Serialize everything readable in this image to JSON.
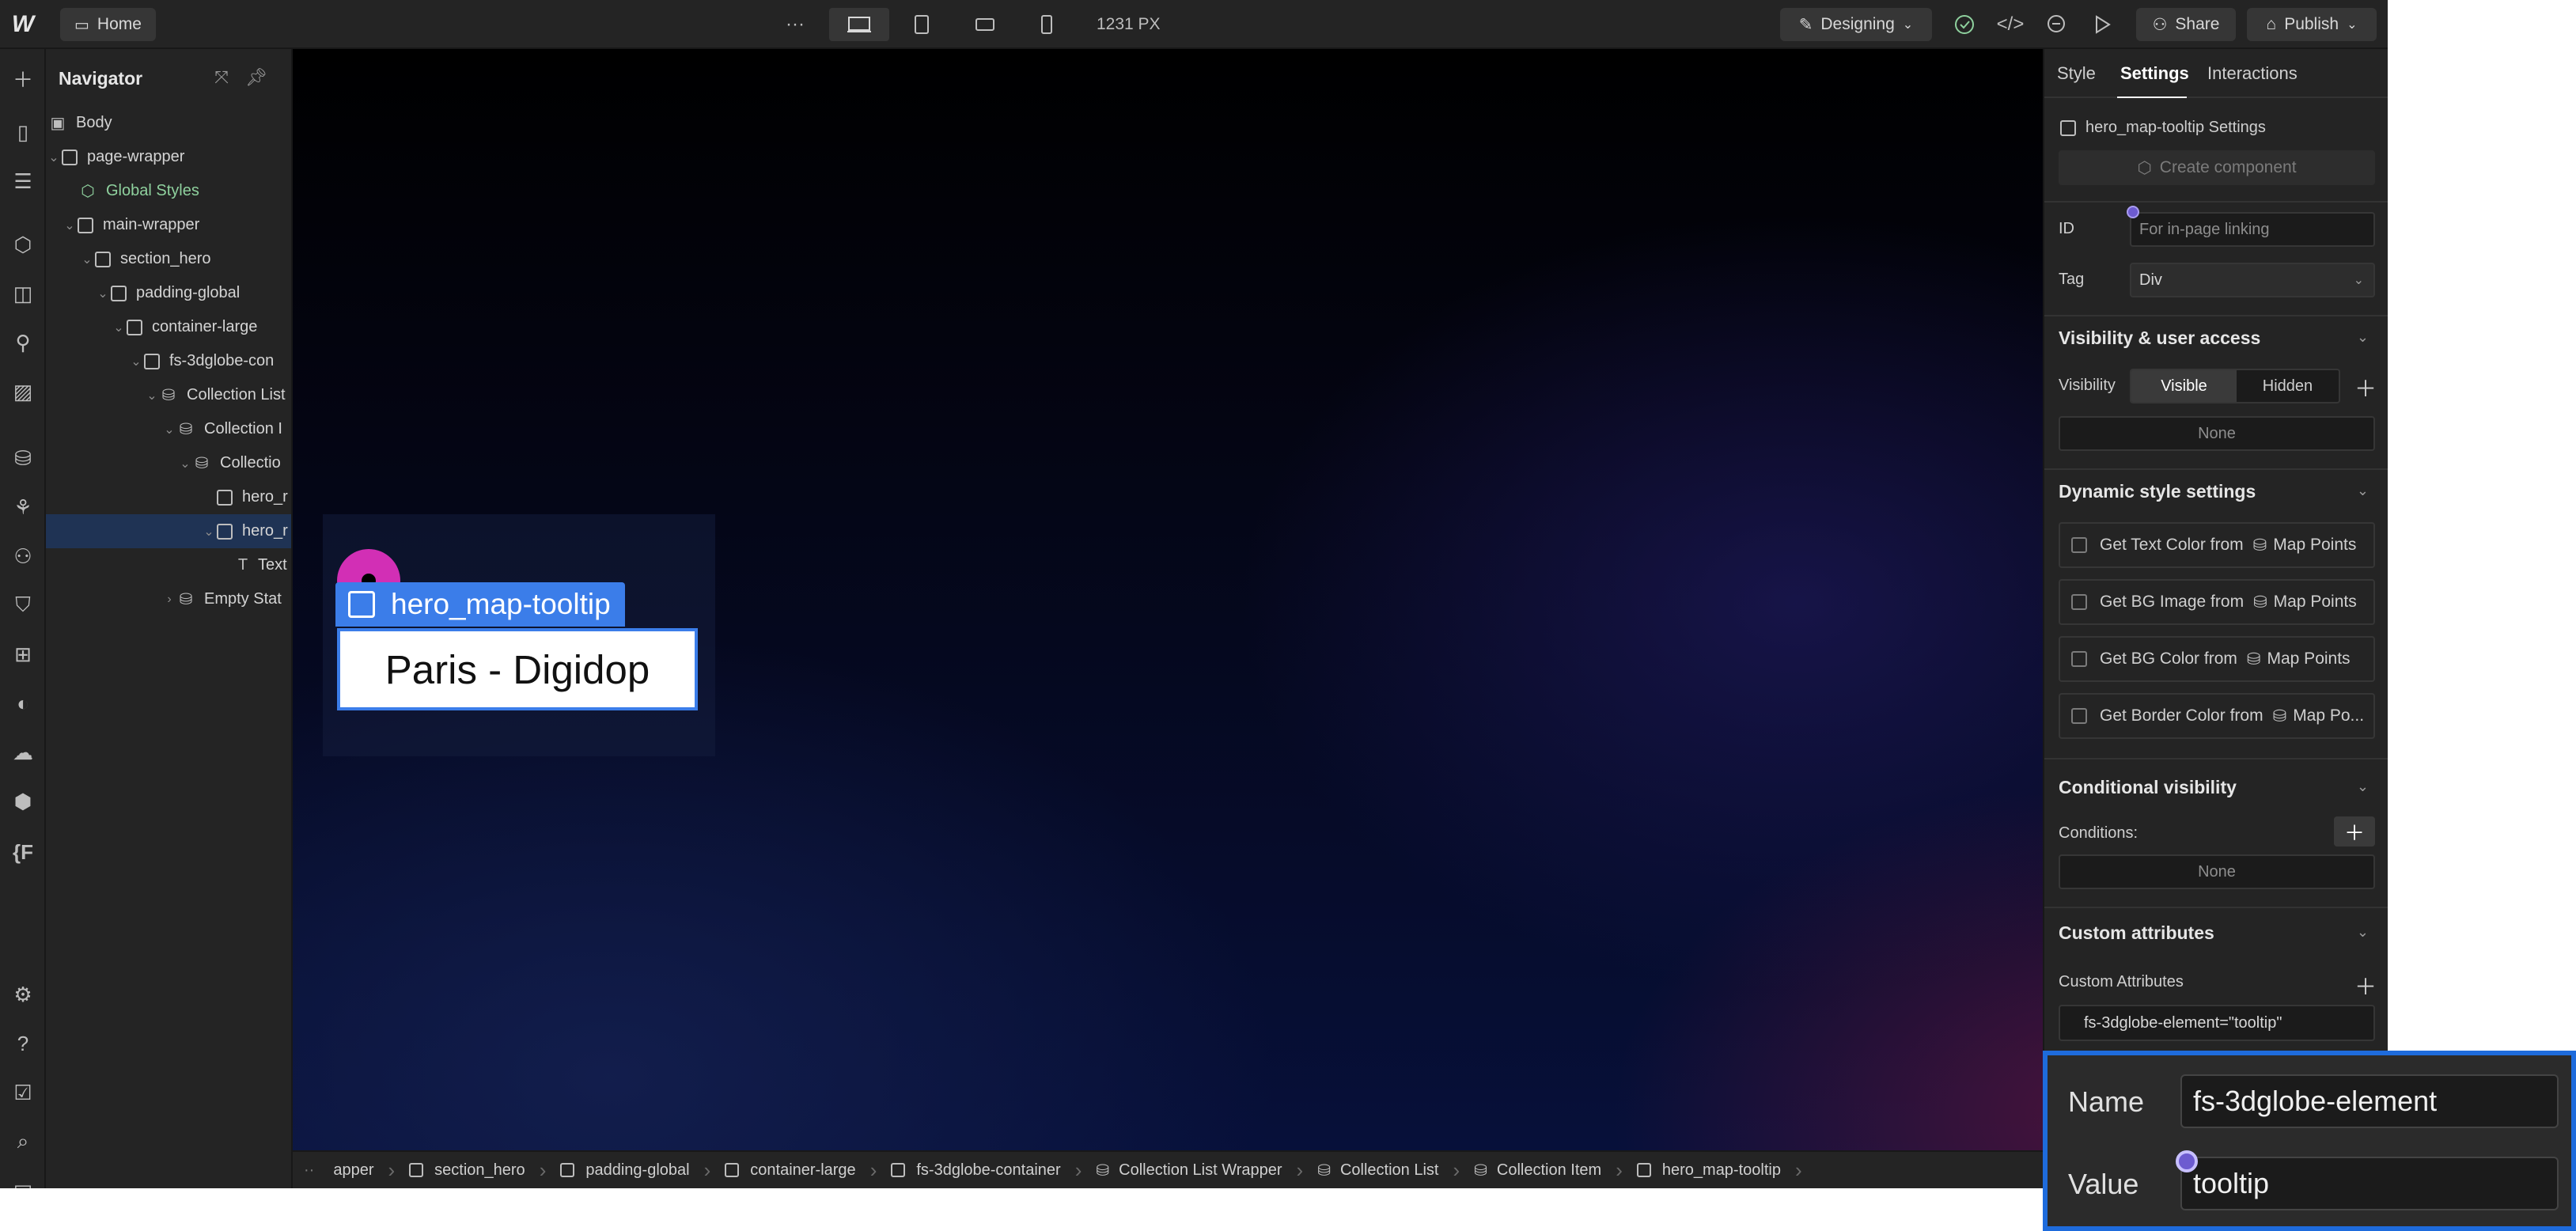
{
  "topbar": {
    "home_label": "Home",
    "width_label": "1231 PX",
    "mode_label": "Designing",
    "share_label": "Share",
    "publish_label": "Publish",
    "more_glyph": "···"
  },
  "navigator": {
    "title": "Navigator",
    "items": [
      {
        "label": "Body"
      },
      {
        "label": "page-wrapper"
      },
      {
        "label": "Global Styles"
      },
      {
        "label": "main-wrapper"
      },
      {
        "label": "section_hero"
      },
      {
        "label": "padding-global"
      },
      {
        "label": "container-large"
      },
      {
        "label": "fs-3dglobe-con"
      },
      {
        "label": "Collection List"
      },
      {
        "label": "Collection I"
      },
      {
        "label": "Collectio"
      },
      {
        "label": "hero_r"
      },
      {
        "label": "hero_r"
      },
      {
        "label": "Text"
      },
      {
        "label": "Empty Stat"
      }
    ]
  },
  "canvas": {
    "selected_label": "hero_map-tooltip",
    "tooltip_text": "Paris - Digidop"
  },
  "breadcrumb": [
    {
      "label": "apper"
    },
    {
      "label": "section_hero"
    },
    {
      "label": "padding-global"
    },
    {
      "label": "container-large"
    },
    {
      "label": "fs-3dglobe-container"
    },
    {
      "label": "Collection List Wrapper"
    },
    {
      "label": "Collection List"
    },
    {
      "label": "Collection Item"
    },
    {
      "label": "hero_map-tooltip"
    }
  ],
  "panel": {
    "tabs": {
      "style": "Style",
      "settings": "Settings",
      "interactions": "Interactions"
    },
    "settings_title": "hero_map-tooltip Settings",
    "create_component": "Create component",
    "id_label": "ID",
    "id_placeholder": "For in-page linking",
    "tag_label": "Tag",
    "tag_value": "Div",
    "visibility_section": "Visibility & user access",
    "visibility_label": "Visibility",
    "visible_option": "Visible",
    "hidden_option": "Hidden",
    "visibility_none": "None",
    "dynamic_section": "Dynamic style settings",
    "dynamic_rows": [
      {
        "label": "Get Text Color from",
        "source": "Map Points"
      },
      {
        "label": "Get BG Image from",
        "source": "Map Points"
      },
      {
        "label": "Get BG Color from",
        "source": "Map Points"
      },
      {
        "label": "Get Border Color from",
        "source": "Map Po..."
      }
    ],
    "conditional_section": "Conditional visibility",
    "conditions_label": "Conditions:",
    "conditions_none": "None",
    "custom_section": "Custom attributes",
    "custom_label": "Custom Attributes",
    "attribute_text": "fs-3dglobe-element=\"tooltip\""
  },
  "zoom": {
    "name_label": "Name",
    "name_value": "fs-3dglobe-element",
    "value_label": "Value",
    "value_value": "tooltip"
  },
  "colors": {
    "accent_blue": "#3b7de9",
    "pin_magenta": "#d22fb5",
    "status_green": "#8fd19e"
  }
}
